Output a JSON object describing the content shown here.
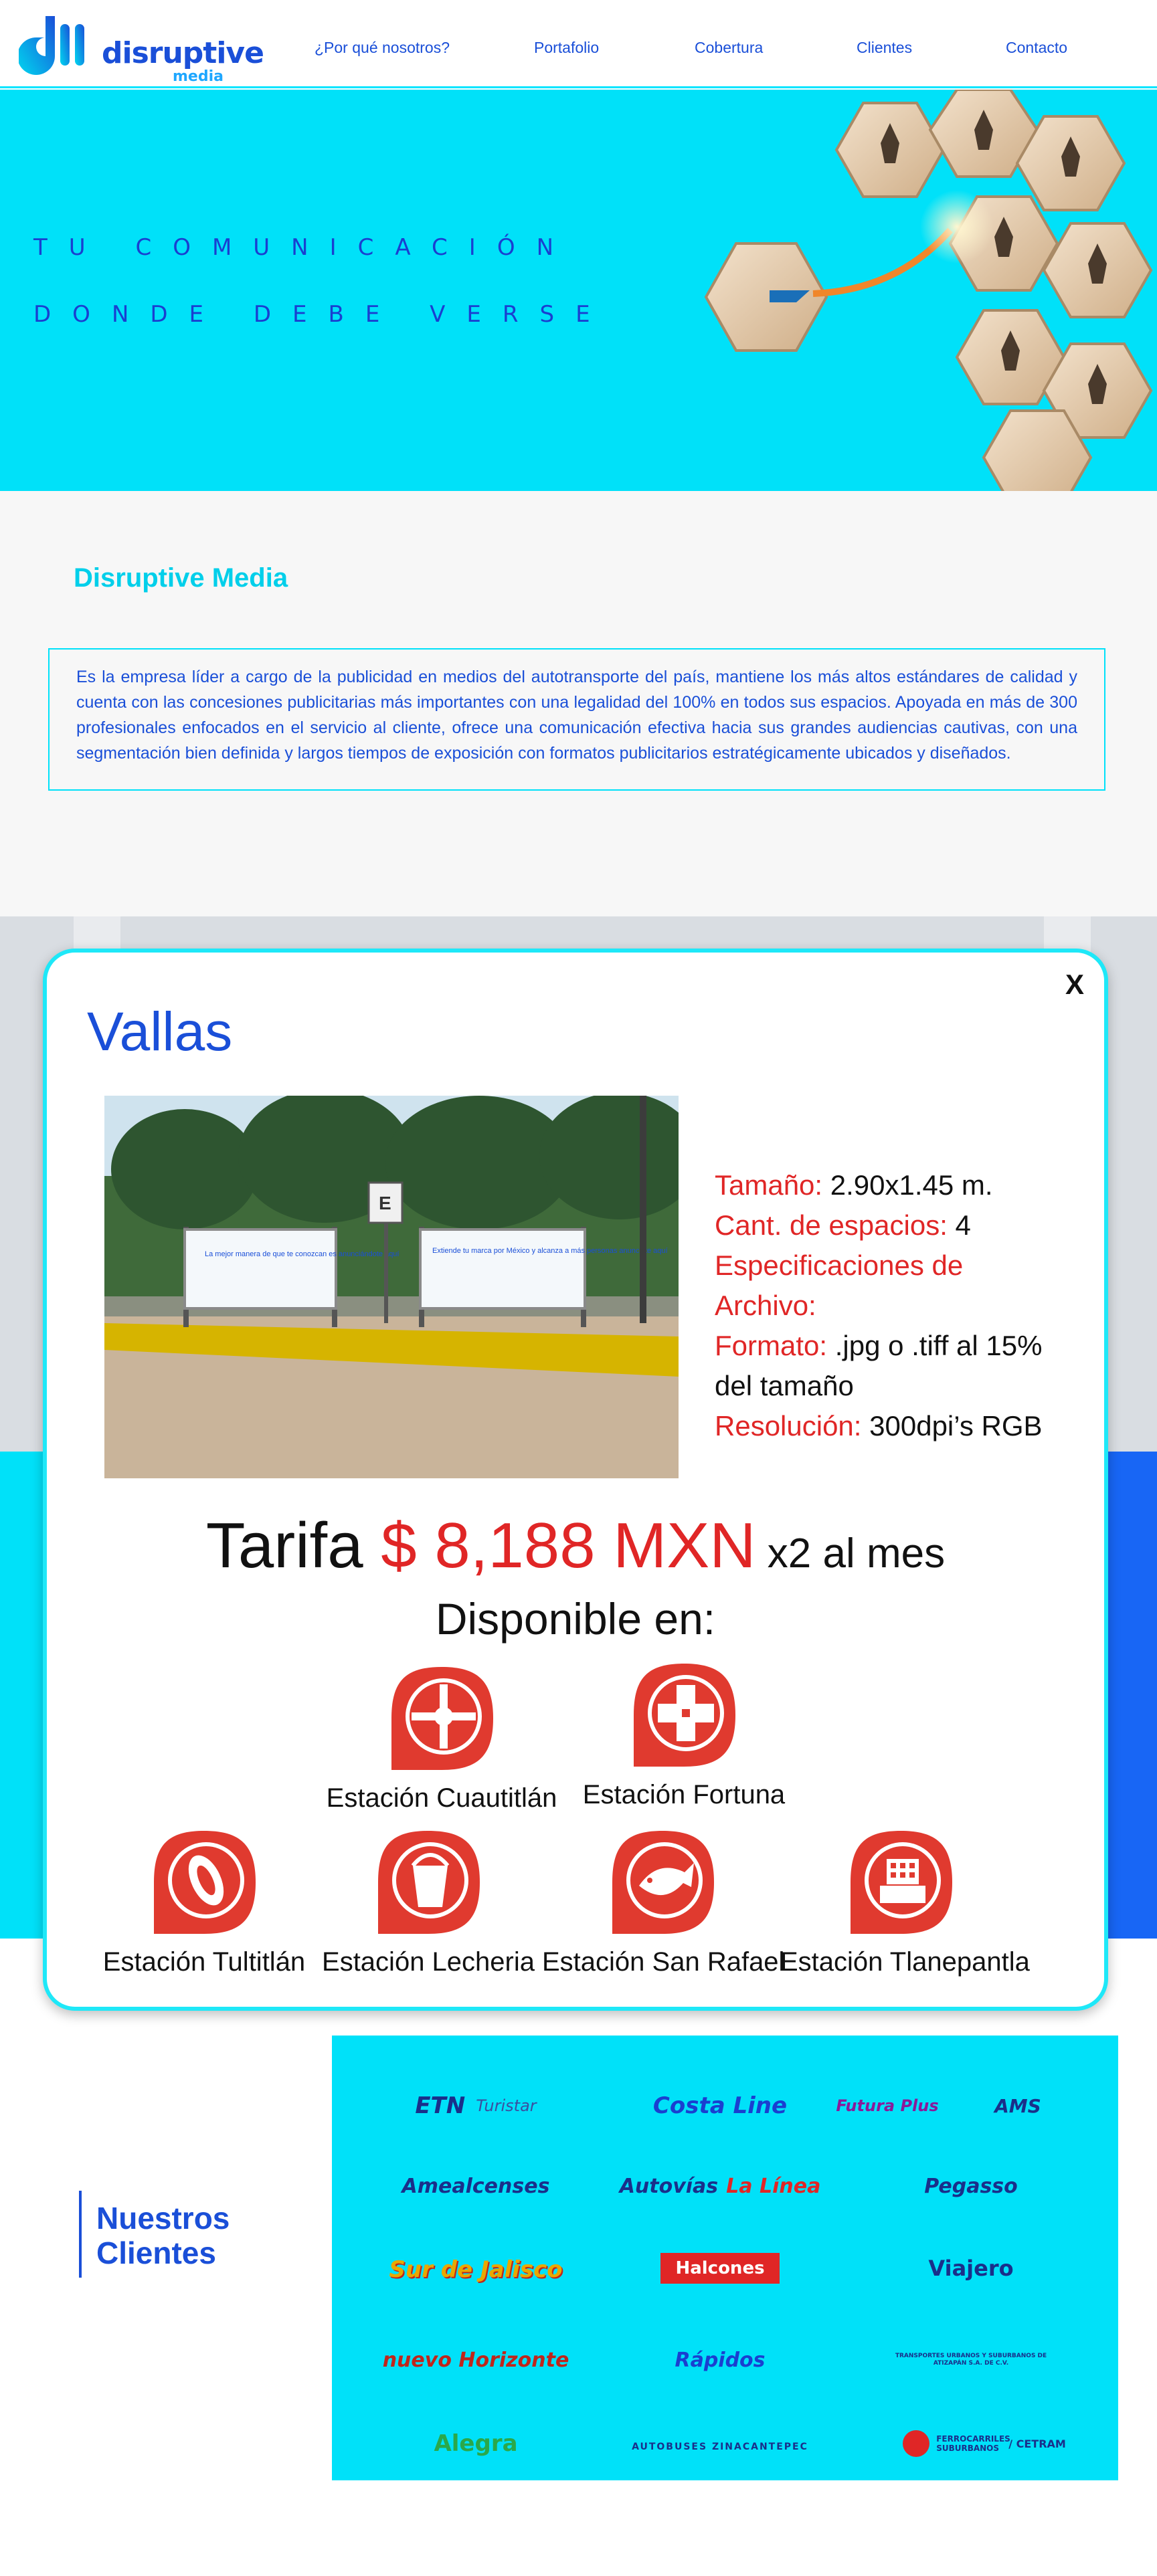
{
  "header": {
    "logo_text": "disruptive",
    "logo_sub": "media",
    "nav": [
      "¿Por qué nosotros?",
      "Portafolio",
      "Cobertura",
      "Clientes",
      "Contacto"
    ]
  },
  "hero": {
    "line1": "TU COMUNICACIÓN",
    "line2": "DONDE DEBE VERSE"
  },
  "intro": {
    "title": "Disruptive Media",
    "text": "Es la empresa líder a cargo de la publicidad en medios del  autotransporte del país, mantiene los más altos estándares de calidad y cuenta con las concesiones publicitarias más importantes  con una legalidad del 100% en todos sus espacios. Apoyada en más de 300 profesionales enfocados en el servicio al cliente, ofrece una comunicación efectiva hacia sus grandes audiencias cautivas, con una segmentación bien definida y largos tiempos de exposición con formatos publicitarios estratégicamente ubicados y diseñados."
  },
  "modal": {
    "close": "X",
    "title": "Vallas",
    "photo": {
      "billboard1": "La mejor manera de que te conozcan es anunciándote aquí",
      "billboard2": "Extiende tu marca por México y alcanza a más personas anunciate aquí",
      "sign": "E"
    },
    "specs": {
      "size_key": "Tamaño:",
      "size_val": " 2.90x1.45 m.",
      "spaces_key": "Cant. de espacios:",
      "spaces_val": " 4",
      "file_key": "Especificaciones de Archivo:",
      "format_key": "Formato:",
      "format_val": " .jpg o .tiff al 15% del tamaño",
      "res_key": "Resolución:",
      "res_val": " 300dpi’s RGB"
    },
    "price": {
      "word": "Tarifa ",
      "value": "$ 8,188 MXN",
      "suffix": " x2 al mes"
    },
    "available": "Disponible en:",
    "stations": [
      {
        "label": "Estación Cuautitlán",
        "icon": "cross-emblem-icon"
      },
      {
        "label": "Estación Fortuna",
        "icon": "plus-cross-emblem-icon"
      },
      {
        "label": "Estación Tultitlán",
        "icon": "glyph-emblem-icon"
      },
      {
        "label": "Estación Lecheria",
        "icon": "milk-pail-icon"
      },
      {
        "label": "Estación San Rafael",
        "icon": "fish-icon"
      },
      {
        "label": "Estación Tlanepantla",
        "icon": "building-icon"
      }
    ],
    "accent_color": "#e02626",
    "frame_color": "#1ee8f8"
  },
  "clients": {
    "title_line1": "Nuestros",
    "title_line2": "Clientes",
    "logos": [
      "ETN",
      "Turistar",
      "Costa Line",
      "Futura Plus",
      "AMS",
      "Amealcenses",
      "Autovías",
      "La Línea",
      "Pegasso",
      "Sur de Jalisco",
      "Halcones",
      "Viajero",
      "nuevo Horizonte",
      "Rápidos",
      "TRANSPORTES URBANOS Y SUBURBANOS DE ATIZAPÁN S.A. DE C.V.",
      "Alegra",
      "AUTOBUSES ZINACANTEPEC",
      "FERROCARRILES SUBURBANOS",
      "/ CETRAM"
    ]
  }
}
